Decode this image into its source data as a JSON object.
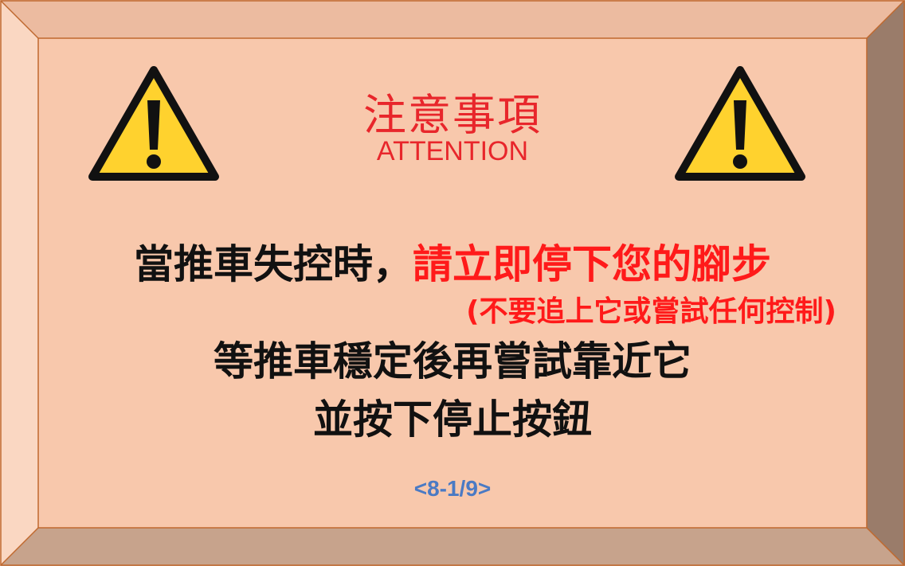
{
  "notice": {
    "title_zh": "注意事項",
    "title_en": "ATTENTION",
    "line1_black": "當推車失控時，",
    "line1_red": "請立即停下您的腳步",
    "note_red": "(不要追上它或嘗試任何控制)",
    "line3": "等推車穩定後再嘗試靠近它",
    "line4": "並按下停止按鈕",
    "page_indicator": "<8-1/9>"
  },
  "icons": {
    "left": "warning-triangle-icon",
    "right": "warning-triangle-icon"
  },
  "colors": {
    "panel_face": "#f8c8ac",
    "bevel_top": "#ecbba0",
    "bevel_left": "#fad7c2",
    "bevel_right": "#9a7c6a",
    "bevel_bottom": "#c7a38c",
    "border": "#c0692f",
    "title_red": "#e8262b",
    "alert_red": "#ff1a1a",
    "page_indicator_blue": "#4a7ac4",
    "warning_yellow": "#ffd22e"
  }
}
